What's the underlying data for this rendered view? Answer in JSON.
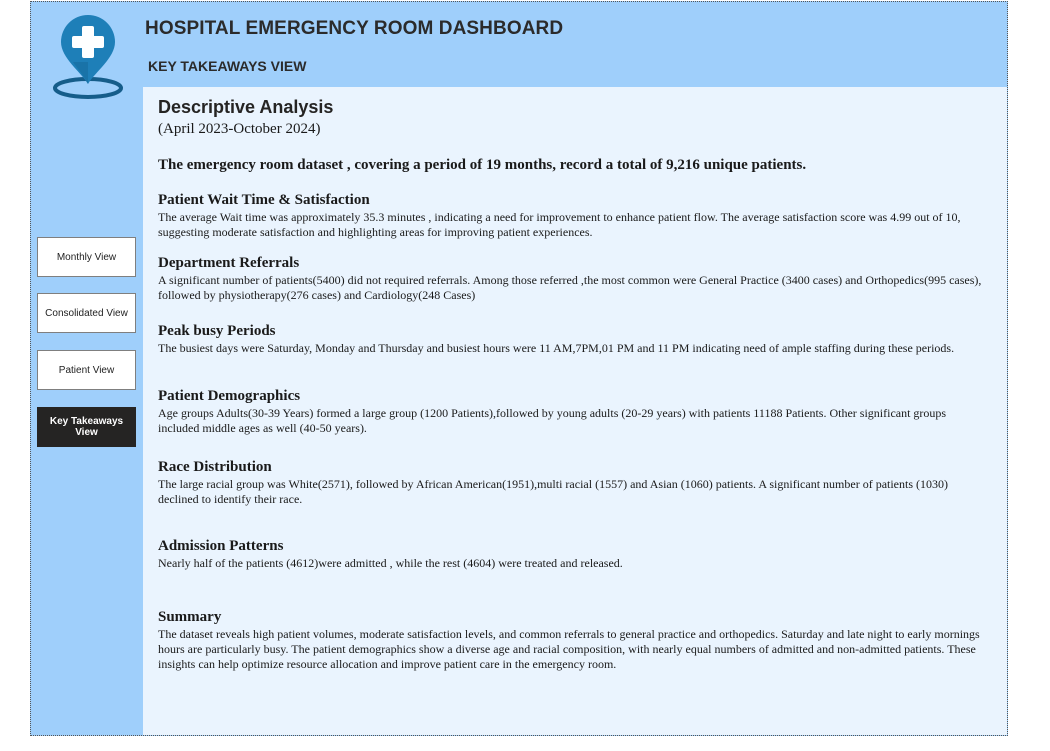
{
  "header": {
    "title": "HOSPITAL EMERGENCY ROOM DASHBOARD",
    "subtitle": "KEY TAKEAWAYS  VIEW",
    "logo_icon": "hospital-location-pin-icon"
  },
  "colors": {
    "frame_bg": "#9fcffb",
    "content_bg": "#eaf4fe",
    "logo_blue": "#1e7fb8",
    "logo_dark": "#155d8a",
    "active_button": "#252423"
  },
  "nav": {
    "items": [
      {
        "label": "Monthly View",
        "active": false
      },
      {
        "label": "Consolidated View",
        "active": false
      },
      {
        "label": "Patient View",
        "active": false
      },
      {
        "label": "Key Takeaways View",
        "active": true
      }
    ]
  },
  "main": {
    "heading": "Descriptive Analysis",
    "period": "(April 2023-October 2024)",
    "intro": "The emergency room dataset , covering a period of 19 months, record a total of 9,216 unique patients.",
    "sections": [
      {
        "title": "Patient Wait Time & Satisfaction",
        "body": "The average Wait time was approximately 35.3 minutes , indicating a need for improvement to enhance patient flow. The average satisfaction score was 4.99 out of 10, suggesting moderate satisfaction and highlighting areas for improving patient experiences."
      },
      {
        "title": "Department Referrals",
        "body": "A significant number of patients(5400) did not required referrals. Among those referred ,the most common were General Practice (3400 cases) and Orthopedics(995 cases), followed by physiotherapy(276 cases) and Cardiology(248 Cases)"
      },
      {
        "title": "Peak busy Periods",
        "body": "The busiest days were Saturday, Monday and Thursday and busiest hours were 11 AM,7PM,01 PM and 11 PM indicating need of ample staffing during these periods."
      },
      {
        "title": "Patient Demographics",
        "body": "Age groups Adults(30-39 Years) formed a large group (1200 Patients),followed by young adults (20-29 years) with patients 11188 Patients. Other significant groups included middle ages as well (40-50 years)."
      },
      {
        "title": "Race Distribution",
        "body": "The large racial group was White(2571), followed by African American(1951),multi racial (1557) and Asian (1060) patients. A significant number of patients (1030) declined to identify their race."
      },
      {
        "title": "Admission Patterns",
        "body": "Nearly half of the patients (4612)were admitted , while the rest (4604) were treated and released."
      },
      {
        "title": "Summary",
        "body": "The dataset reveals high patient volumes, moderate satisfaction levels, and common referrals to general practice and orthopedics. Saturday and late night to early mornings hours are particularly busy. The patient demographics show a diverse age and racial composition, with nearly equal numbers of admitted and non-admitted patients. These insights can help optimize resource allocation and improve patient care in the emergency room."
      }
    ]
  }
}
